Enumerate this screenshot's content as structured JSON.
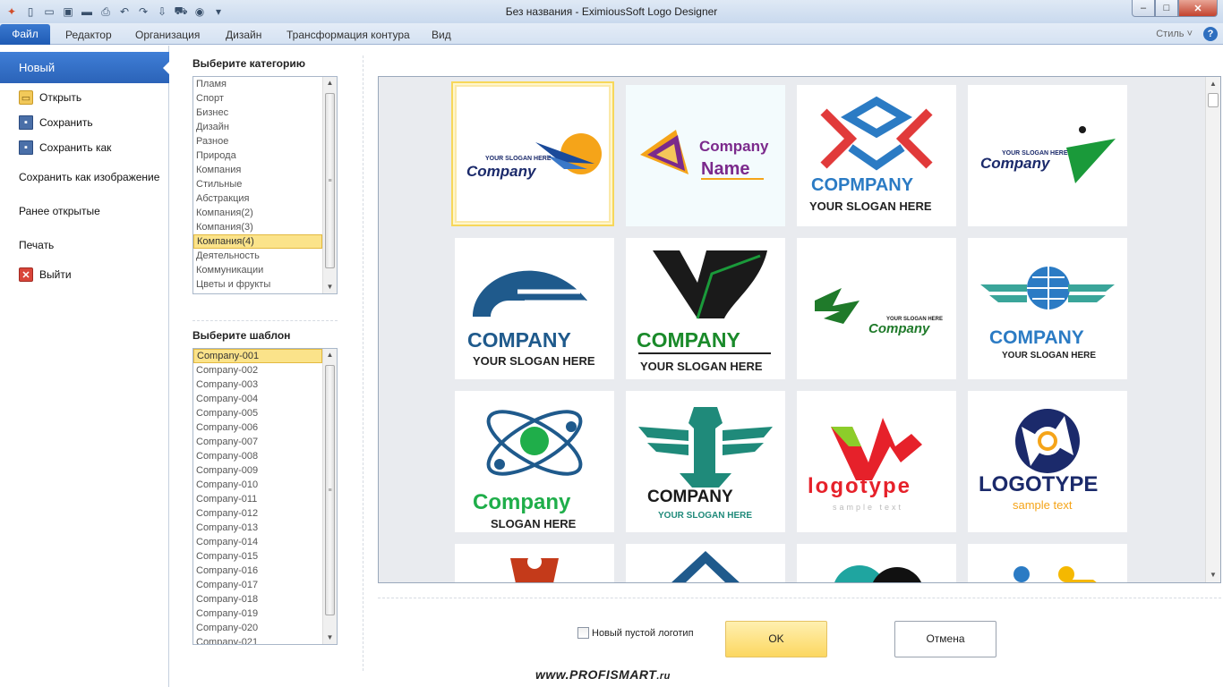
{
  "window": {
    "title": "Без названия - EximiousSoft Logo Designer",
    "buttons": {
      "minimize": "–",
      "maximize": "□",
      "close": "✕"
    }
  },
  "qat_icons": [
    "app-logo-icon",
    "new-icon",
    "open-icon",
    "save-icon",
    "print-preview-icon",
    "print-icon",
    "undo-icon",
    "redo-icon",
    "import-icon",
    "shopping-cart-icon",
    "help-icon",
    "dropdown-icon"
  ],
  "ribbon": {
    "tabs": [
      "Файл",
      "Редактор",
      "Организация",
      "Дизайн",
      "Трансформация контура",
      "Вид"
    ],
    "style_label": "Стиль ˅",
    "help_glyph": "?"
  },
  "file_menu": {
    "new": "Новый",
    "open": "Открыть",
    "save": "Сохранить",
    "save_as": "Сохранить как",
    "save_as_image": "Сохранить как изображение",
    "recent": "Ранее открытые",
    "print": "Печать",
    "exit": "Выйти"
  },
  "category": {
    "heading": "Выберите категорию",
    "items": [
      "Пламя",
      "Спорт",
      "Бизнес",
      "Дизайн",
      "Разное",
      "Природа",
      "Компания",
      "Стильные",
      "Абстракция",
      "Компания(2)",
      "Компания(3)",
      "Компания(4)",
      "Деятельность",
      "Коммуникации",
      "Цветы и фрукты"
    ],
    "selected": "Компания(4)"
  },
  "template": {
    "heading": "Выберите шаблон",
    "items": [
      "Company-001",
      "Company-002",
      "Company-003",
      "Company-004",
      "Company-005",
      "Company-006",
      "Company-007",
      "Company-008",
      "Company-009",
      "Company-010",
      "Company-011",
      "Company-012",
      "Company-013",
      "Company-014",
      "Company-015",
      "Company-016",
      "Company-017",
      "Company-018",
      "Company-019",
      "Company-020",
      "Company-021"
    ],
    "selected": "Company-001"
  },
  "logos": [
    {
      "slogan": "YOUR SLOGAN HERE",
      "name": "Company"
    },
    {
      "line1": "Company",
      "line2": "Name"
    },
    {
      "name": "COPMPANY",
      "slogan": "YOUR SLOGAN HERE"
    },
    {
      "slogan": "YOUR SLOGAN HERE",
      "name": "Company"
    },
    {
      "name": "COMPANY",
      "slogan": "YOUR SLOGAN HERE"
    },
    {
      "name": "COMPANY",
      "slogan": "YOUR SLOGAN HERE"
    },
    {
      "slogan": "YOUR SLOGAN HERE",
      "name": "Company"
    },
    {
      "name": "COMPANY",
      "slogan": "YOUR SLOGAN HERE"
    },
    {
      "name": "Company",
      "slogan": "SLOGAN HERE"
    },
    {
      "name": "COMPANY",
      "slogan": "YOUR SLOGAN HERE"
    },
    {
      "name": "logotype",
      "slogan": "sample text"
    },
    {
      "name": "LOGOTYPE",
      "slogan": "sample text"
    },
    {},
    {},
    {},
    {}
  ],
  "colors": {
    "file_tab": "#2b63b8",
    "selection": "#fbe38a",
    "ok_button": "#fcd761"
  },
  "footer": {
    "blank_logo": "Новый пустой логотип",
    "ok": "OK",
    "cancel": "Отмена"
  },
  "watermark": {
    "main": "www.PROFISMART",
    "suffix": ".ru"
  }
}
